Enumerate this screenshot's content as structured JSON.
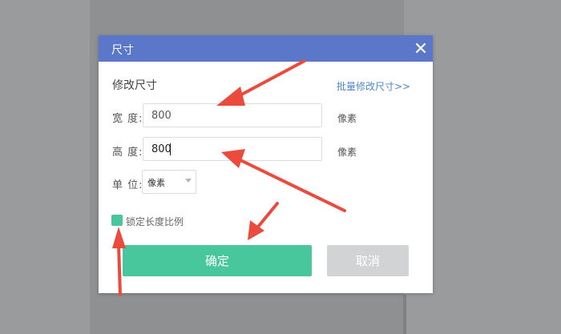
{
  "dialog": {
    "title": "尺寸",
    "section_title": "修改尺寸",
    "batch_link": "批量修改尺寸>>",
    "width": {
      "label": "宽 度:",
      "value": "800",
      "unit": "像素"
    },
    "height": {
      "label": "高 度:",
      "value": "800",
      "unit": "像素"
    },
    "unit": {
      "label": "单 位:",
      "selected": "像素"
    },
    "lock_ratio": {
      "label": "锁定长度比例",
      "checked": true
    },
    "confirm_label": "确定",
    "cancel_label": "取消"
  },
  "colors": {
    "header": "#5a77c9",
    "accent_green": "#48c69c",
    "link_blue": "#4e86c9",
    "annotation_red": "#ea4b3d"
  },
  "icons": [
    "close-icon",
    "chevron-down-icon",
    "annotation-arrow"
  ]
}
